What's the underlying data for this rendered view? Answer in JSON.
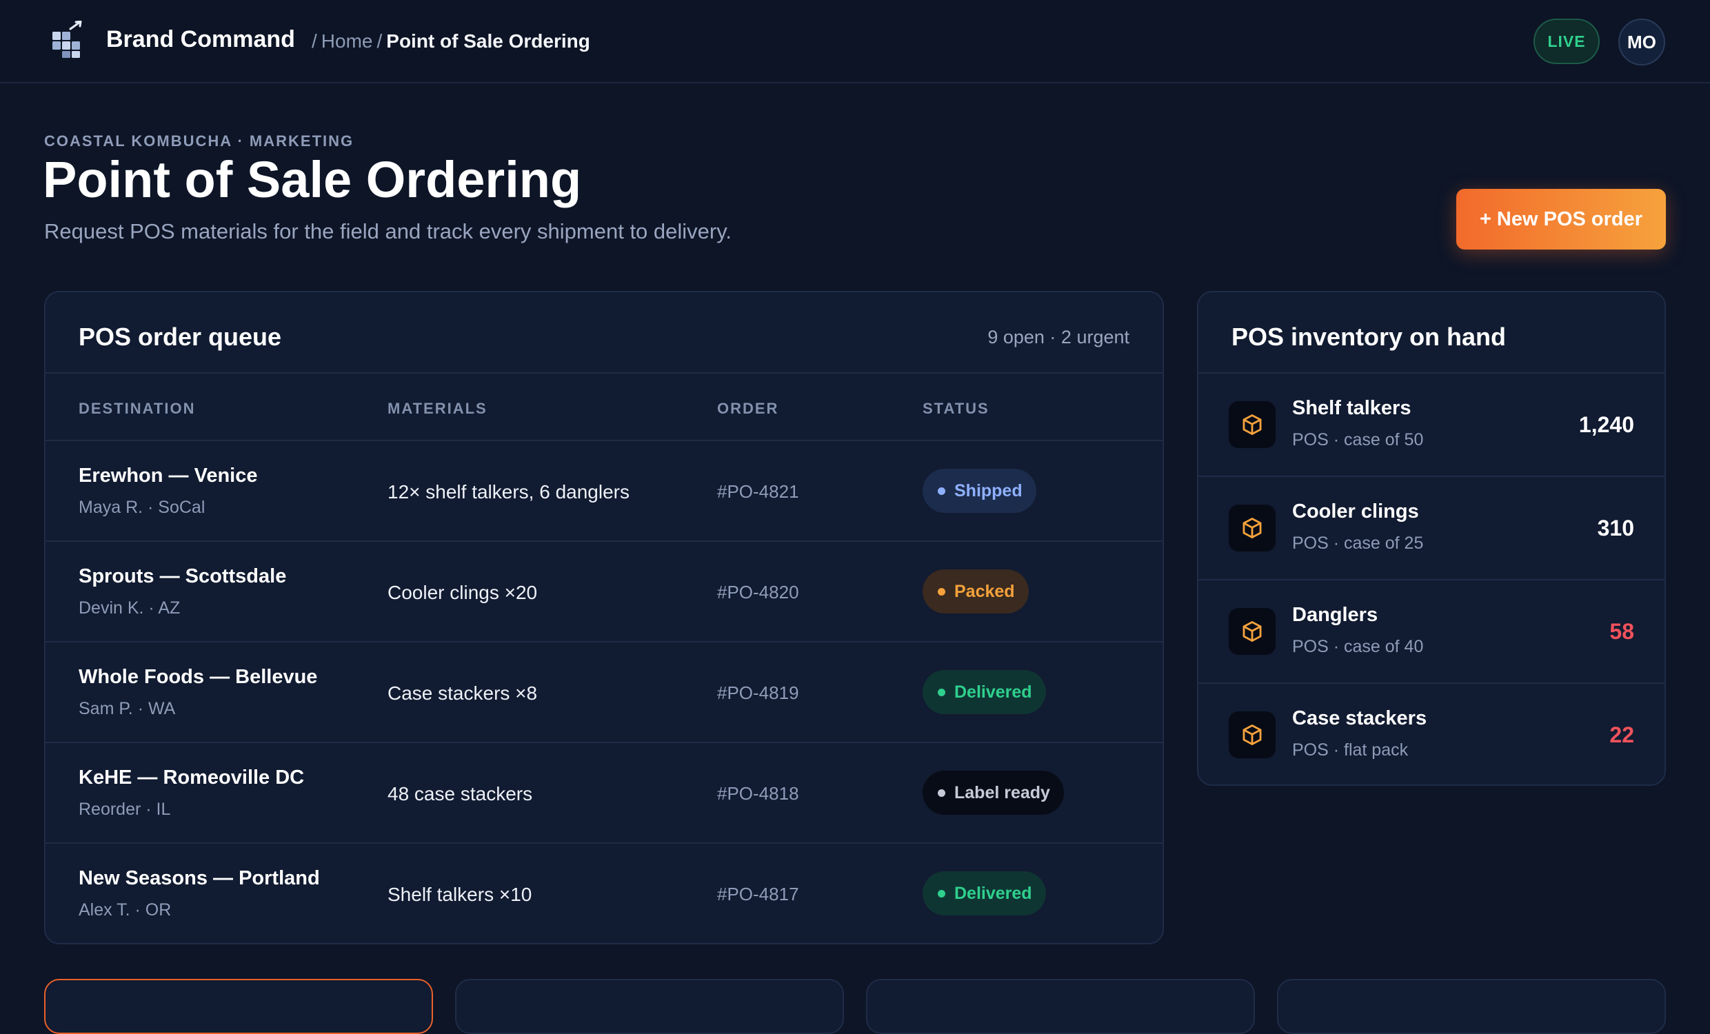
{
  "header": {
    "brand": "Brand Command",
    "breadcrumb_sep": "/",
    "breadcrumb_home": "Home",
    "breadcrumb_current": "Point of Sale Ordering",
    "live_label": "LIVE",
    "avatar_initials": "MO"
  },
  "page": {
    "eyebrow": "COASTAL KOMBUCHA · MARKETING",
    "title": "Point of Sale Ordering",
    "subtitle": "Request POS materials for the field and track every shipment to delivery.",
    "new_order_label": "+ New POS order"
  },
  "queue": {
    "title": "POS order queue",
    "meta": "9 open · 2 urgent",
    "columns": [
      "DESTINATION",
      "MATERIALS",
      "ORDER",
      "STATUS"
    ],
    "rows": [
      {
        "destination": "Erewhon — Venice",
        "contact": "Maya R. · SoCal",
        "materials": "12× shelf talkers, 6 danglers",
        "order": "#PO-4821",
        "status": "Shipped",
        "status_kind": "shipped"
      },
      {
        "destination": "Sprouts — Scottsdale",
        "contact": "Devin K. · AZ",
        "materials": "Cooler clings ×20",
        "order": "#PO-4820",
        "status": "Packed",
        "status_kind": "packed"
      },
      {
        "destination": "Whole Foods — Bellevue",
        "contact": "Sam P. · WA",
        "materials": "Case stackers ×8",
        "order": "#PO-4819",
        "status": "Delivered",
        "status_kind": "delivered"
      },
      {
        "destination": "KeHE — Romeoville DC",
        "contact": "Reorder · IL",
        "materials": "48 case stackers",
        "order": "#PO-4818",
        "status": "Label ready",
        "status_kind": "label"
      },
      {
        "destination": "New Seasons — Portland",
        "contact": "Alex T. · OR",
        "materials": "Shelf talkers ×10",
        "order": "#PO-4817",
        "status": "Delivered",
        "status_kind": "delivered"
      }
    ]
  },
  "inventory": {
    "title": "POS inventory on hand",
    "items": [
      {
        "name": "Shelf talkers",
        "sub": "POS · case of 50",
        "count": "1,240",
        "level": "ok",
        "icon": "box-icon"
      },
      {
        "name": "Cooler clings",
        "sub": "POS · case of 25",
        "count": "310",
        "level": "ok",
        "icon": "box-icon"
      },
      {
        "name": "Danglers",
        "sub": "POS · case of 40",
        "count": "58",
        "level": "low",
        "icon": "box-icon"
      },
      {
        "name": "Case stackers",
        "sub": "POS · flat pack",
        "count": "22",
        "level": "low",
        "icon": "box-icon"
      }
    ]
  },
  "colors": {
    "accent": "#f26a2b",
    "shipped": "#8fb0ff",
    "packed": "#f5a23c",
    "delivered": "#2fd08d",
    "label": "#c5cbd8",
    "low_stock": "#f0525c",
    "ok_stock": "#ffffff"
  }
}
